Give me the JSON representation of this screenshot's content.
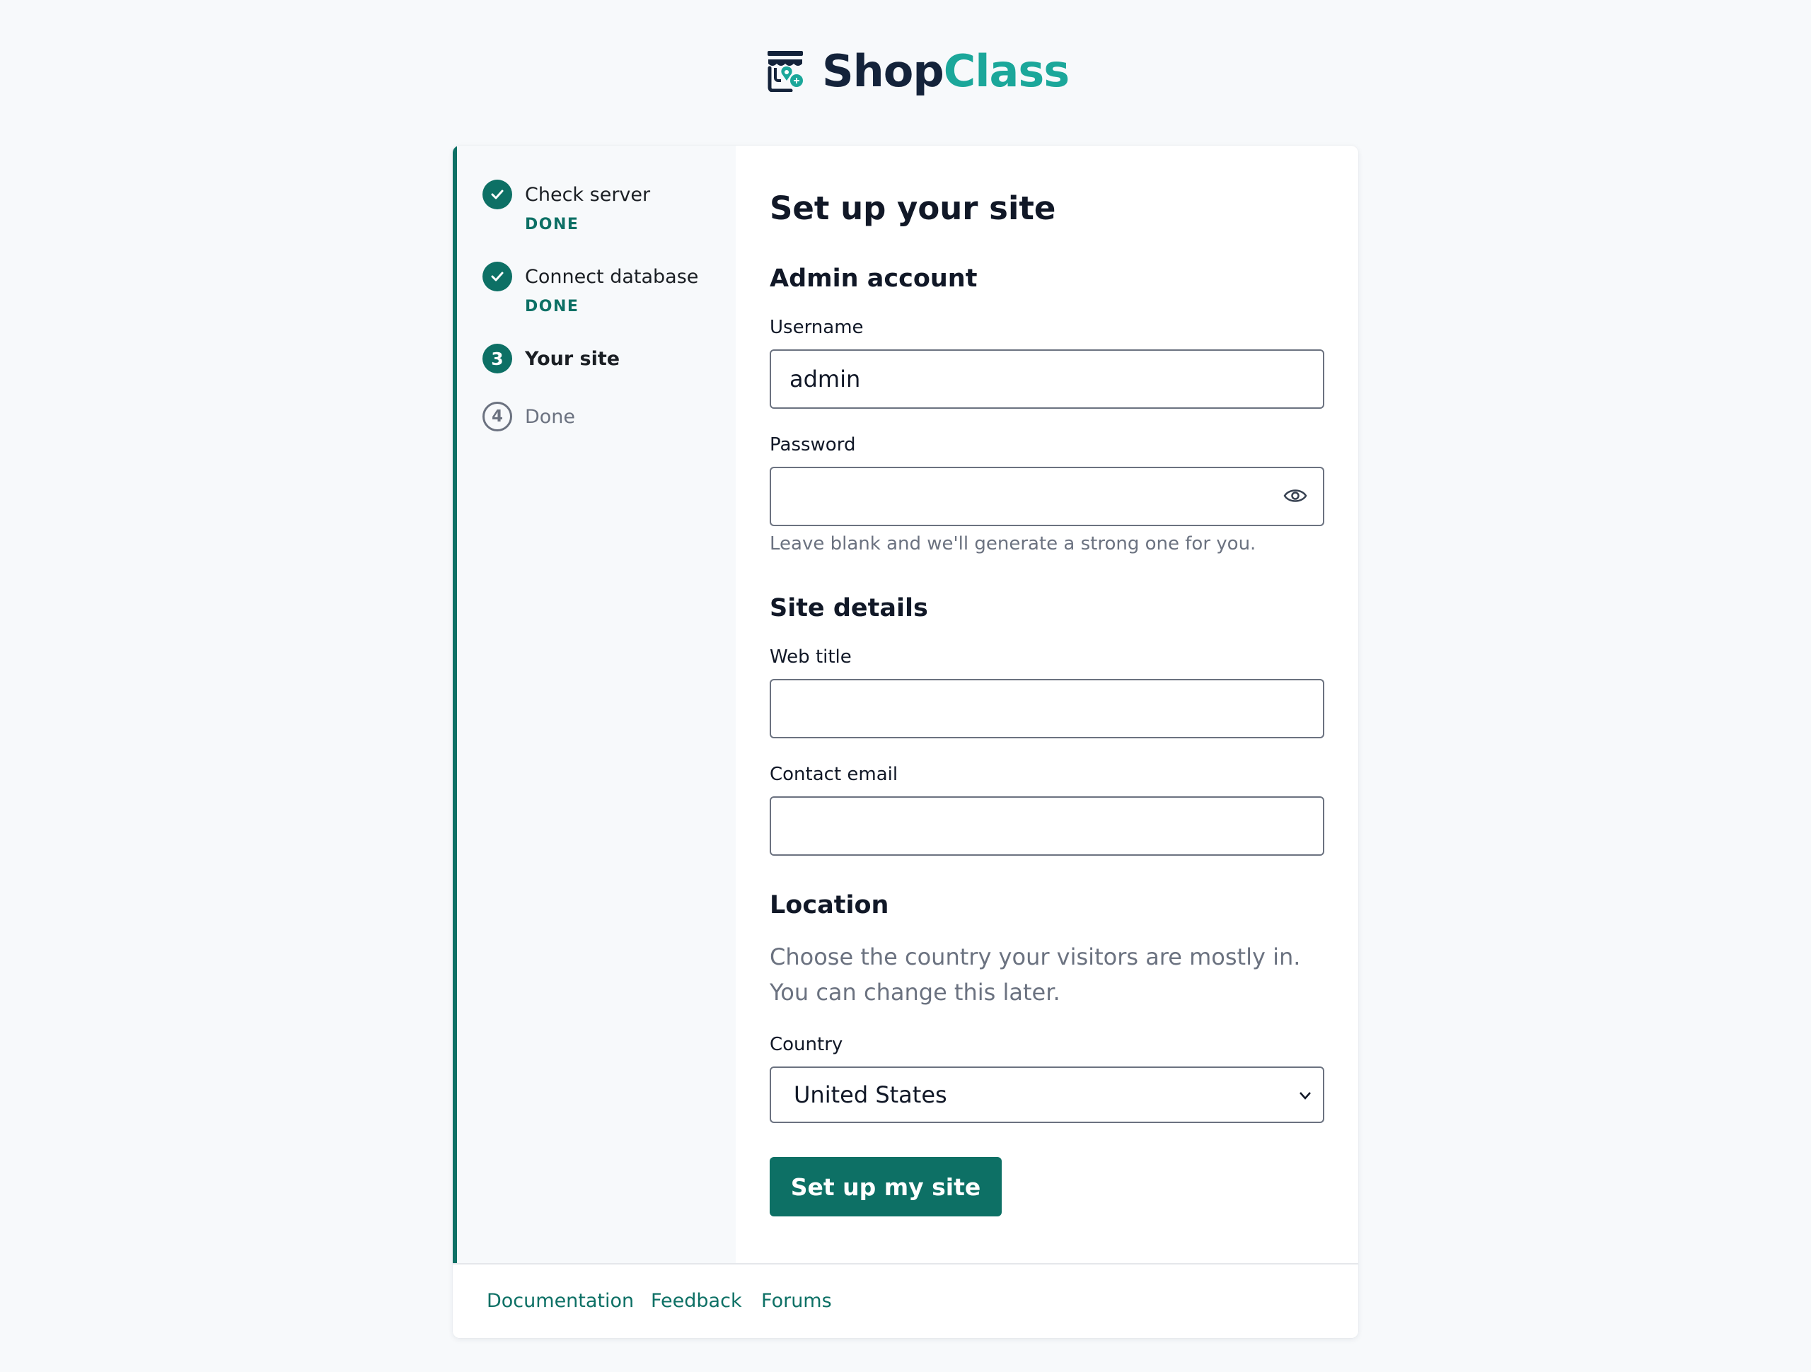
{
  "brand": {
    "name_part1": "Shop",
    "name_part2": "Class",
    "icon": "shopclass-logo-icon"
  },
  "steps": [
    {
      "label": "Check server",
      "status": "DONE",
      "icon": "check-icon",
      "state": "done"
    },
    {
      "label": "Connect database",
      "status": "DONE",
      "icon": "check-icon",
      "state": "done"
    },
    {
      "label": "Your site",
      "number": "3",
      "state": "current"
    },
    {
      "label": "Done",
      "number": "4",
      "state": "pending"
    }
  ],
  "form": {
    "title": "Set up your site",
    "admin_heading": "Admin account",
    "username_label": "Username",
    "username_value": "admin",
    "password_label": "Password",
    "password_value": "",
    "password_hint": "Leave blank and we'll generate a strong one for you.",
    "password_toggle_icon": "eye-icon",
    "site_heading": "Site details",
    "web_title_label": "Web title",
    "web_title_value": "",
    "contact_email_label": "Contact email",
    "contact_email_value": "",
    "location_heading": "Location",
    "location_help": "Choose the country your visitors are mostly in. You can change this later.",
    "country_label": "Country",
    "country_value": "United States",
    "submit_label": "Set up my site"
  },
  "footer": {
    "links": [
      "Documentation",
      "Feedback",
      "Forums"
    ]
  },
  "colors": {
    "accent": "#0d7065",
    "brand_dark": "#14233a",
    "brand_teal": "#1ba79a",
    "page_bg": "#f7f9fb"
  }
}
